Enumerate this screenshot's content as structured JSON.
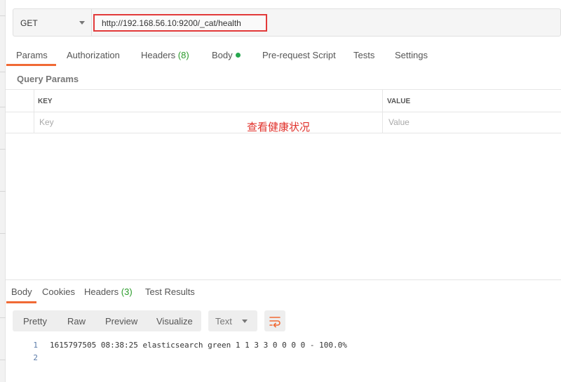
{
  "request": {
    "method": "GET",
    "url": "http://192.168.56.10:9200/_cat/health"
  },
  "request_tabs": [
    {
      "label": "Params"
    },
    {
      "label": "Authorization"
    },
    {
      "label": "Headers",
      "count": "(8)"
    },
    {
      "label": "Body"
    },
    {
      "label": "Pre-request Script"
    },
    {
      "label": "Tests"
    },
    {
      "label": "Settings"
    }
  ],
  "query_params": {
    "title": "Query Params",
    "key_header": "KEY",
    "value_header": "VALUE",
    "key_placeholder": "Key",
    "value_placeholder": "Value"
  },
  "annotation": "查看健康状况",
  "response_tabs": [
    {
      "label": "Body"
    },
    {
      "label": "Cookies"
    },
    {
      "label": "Headers",
      "count": "(3)"
    },
    {
      "label": "Test Results"
    }
  ],
  "view_modes": [
    "Pretty",
    "Raw",
    "Preview",
    "Visualize"
  ],
  "format": "Text",
  "response_lines": [
    {
      "number": "1",
      "text": "1615797505 08:38:25 elasticsearch green 1 1 3 3 0 0 0 0 - 100.0%"
    },
    {
      "number": "2",
      "text": ""
    }
  ],
  "colors": {
    "accent": "#f06a35",
    "highlight_border": "#e23a3a",
    "count_green": "#2a9b2a",
    "annotation": "#e0312b"
  },
  "icons": {
    "body_status": "green-dot-icon",
    "wrap": "word-wrap-icon",
    "method_dropdown": "chevron-down-icon",
    "format_dropdown": "chevron-down-icon"
  }
}
